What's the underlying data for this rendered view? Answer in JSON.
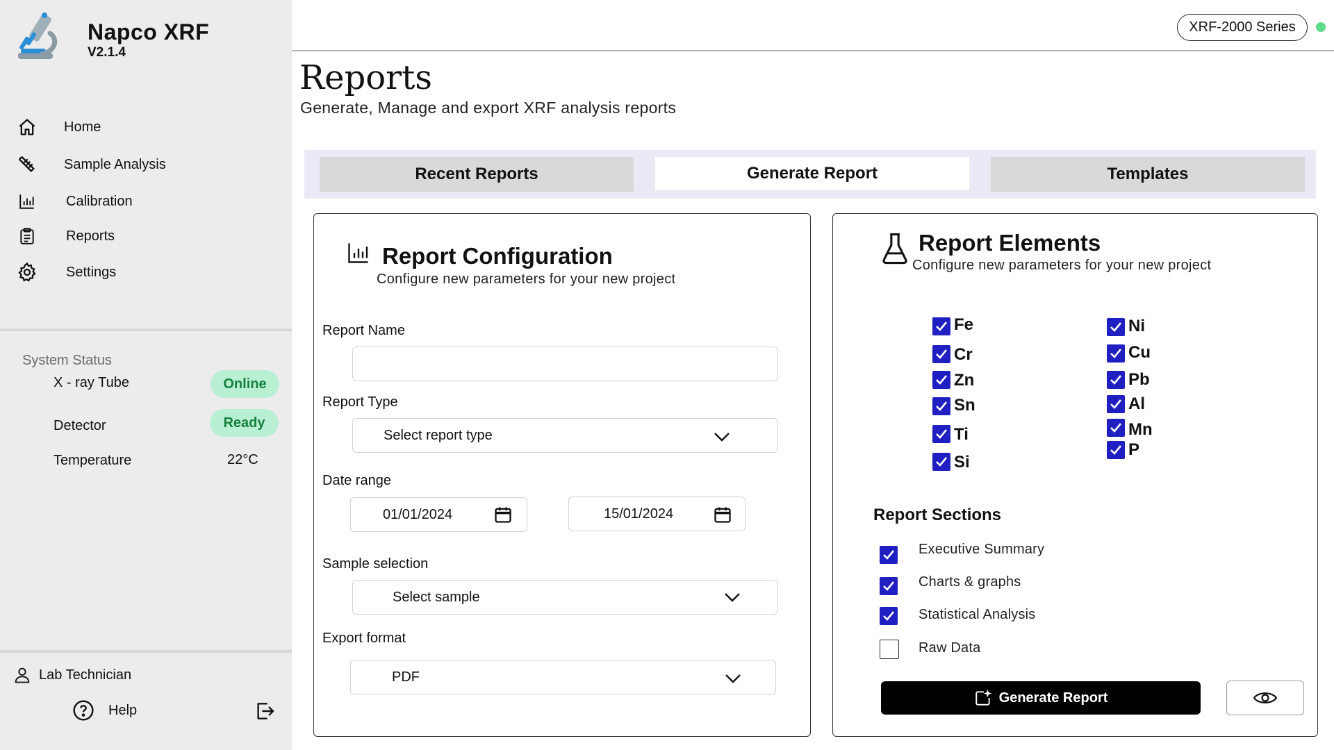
{
  "app": {
    "name": "Napco  XRF",
    "version": "V2.1.4"
  },
  "nav": {
    "home": "Home",
    "sample_analysis": "Sample Analysis",
    "calibration": "Calibration",
    "reports": "Reports",
    "settings": "Settings"
  },
  "system_status": {
    "title": "System Status",
    "xray_label": "X - ray Tube",
    "xray_state": "Online",
    "detector_label": "Detector",
    "detector_state": "Ready",
    "temperature_label": "Temperature",
    "temperature_value": "22°C"
  },
  "user": {
    "role": "Lab Technician",
    "help": "Help"
  },
  "header": {
    "series": "XRF-2000 Series",
    "status_color": "#5ddc8a"
  },
  "page": {
    "title": "Reports",
    "subtitle": "Generate, Manage and export XRF analysis reports"
  },
  "tabs": {
    "recent": "Recent Reports",
    "generate": "Generate Report",
    "templates": "Templates",
    "active": "Generate Report"
  },
  "config": {
    "title": "Report Configuration",
    "subtitle": "Configure new parameters for your new project",
    "report_name_label": "Report Name",
    "report_name_value": "",
    "report_type_label": "Report Type",
    "report_type_value": "Select report type",
    "date_range_label": "Date range",
    "date_from": "01/01/2024",
    "date_to": "15/01/2024",
    "sample_label": "Sample selection",
    "sample_value": "Select sample",
    "export_label": "Export format",
    "export_value": "PDF"
  },
  "elements": {
    "title": "Report Elements",
    "subtitle": "Configure new parameters for your new project",
    "left_column": [
      "Fe",
      "Cr",
      "Zn",
      "Sn",
      "Ti",
      "Si"
    ],
    "right_column": [
      "Ni",
      "Cu",
      "Pb",
      "Al",
      "Mn",
      "P"
    ],
    "all_checked": true
  },
  "sections": {
    "title": "Report Sections",
    "items": [
      {
        "label": "Executive Summary",
        "checked": true
      },
      {
        "label": "Charts & graphs",
        "checked": true
      },
      {
        "label": "Statistical Analysis",
        "checked": true
      },
      {
        "label": "Raw Data",
        "checked": false
      }
    ]
  },
  "actions": {
    "generate": "Generate Report",
    "preview_icon": "eye-icon"
  },
  "colors": {
    "checkbox": "#1f1fc2",
    "pill_bg": "#b9f0d4",
    "pill_text": "#15803d",
    "primary_button": "#000000"
  }
}
